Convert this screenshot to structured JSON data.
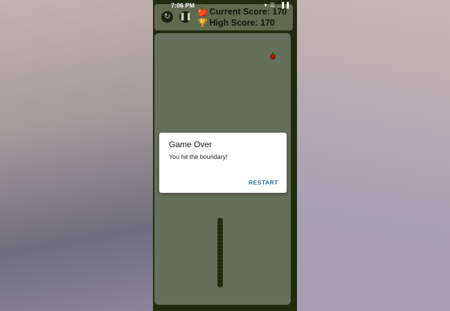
{
  "status_bar": {
    "time": "7:06 PM",
    "icons": "▾ ☰ .▐ ▌"
  },
  "controls": {
    "refresh_icon": "refresh-icon",
    "pause_icon": "pause-icon"
  },
  "scores": {
    "current_label": "Current Score:",
    "current_value": "170",
    "high_label": "High Score:",
    "high_value": "170"
  },
  "dialog": {
    "title": "Game Over",
    "message": "You hit the boundary!",
    "action": "RESTART",
    "action_color": "#1d6fa6"
  },
  "colors": {
    "board": "#65705a",
    "frame": "#1f2d0e",
    "snake": "#1c2a0d",
    "apple": "#9a1e10"
  }
}
